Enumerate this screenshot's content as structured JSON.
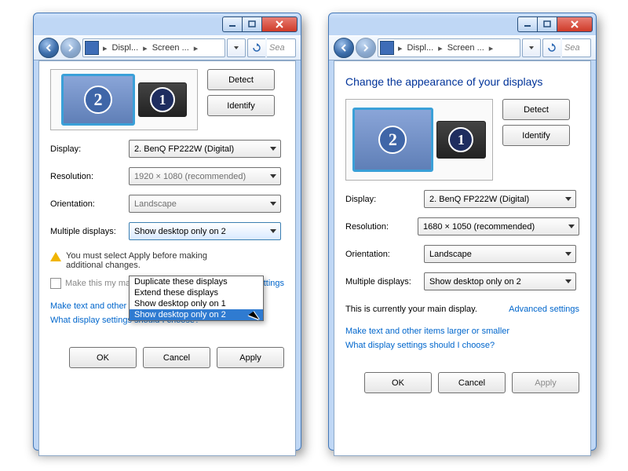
{
  "left": {
    "breadcrumb": {
      "seg1": "Displ...",
      "seg2": "Screen ..."
    },
    "search_placeholder": "Sea",
    "buttons": {
      "detect": "Detect",
      "identify": "Identify"
    },
    "form": {
      "display": {
        "label": "Display:",
        "value": "2. BenQ FP222W (Digital)"
      },
      "resolution": {
        "label": "Resolution:",
        "value": "1920 × 1080 (recommended)"
      },
      "orientation": {
        "label": "Orientation:",
        "value": "Landscape"
      },
      "multiple": {
        "label": "Multiple displays:",
        "value": "Show desktop only on 2"
      }
    },
    "dropdown_options": [
      "Duplicate these displays",
      "Extend these displays",
      "Show desktop only on 1",
      "Show desktop only on 2"
    ],
    "warn": "You must select Apply before making additional changes.",
    "checkbox": "Make this my main display",
    "advanced": "Advanced settings",
    "links": [
      "Make text and other items larger or smaller",
      "What display settings should I choose?"
    ],
    "footer": {
      "ok": "OK",
      "cancel": "Cancel",
      "apply": "Apply"
    }
  },
  "right": {
    "breadcrumb": {
      "seg1": "Displ...",
      "seg2": "Screen ..."
    },
    "search_placeholder": "Sea",
    "heading": "Change the appearance of your displays",
    "buttons": {
      "detect": "Detect",
      "identify": "Identify"
    },
    "form": {
      "display": {
        "label": "Display:",
        "value": "2. BenQ FP222W (Digital)"
      },
      "resolution": {
        "label": "Resolution:",
        "value": "1680 × 1050 (recommended)"
      },
      "orientation": {
        "label": "Orientation:",
        "value": "Landscape"
      },
      "multiple": {
        "label": "Multiple displays:",
        "value": "Show desktop only on 2"
      }
    },
    "status": "This is currently your main display.",
    "advanced": "Advanced settings",
    "links": [
      "Make text and other items larger or smaller",
      "What display settings should I choose?"
    ],
    "footer": {
      "ok": "OK",
      "cancel": "Cancel",
      "apply": "Apply"
    }
  },
  "monitors": {
    "m1": "1",
    "m2": "2"
  }
}
